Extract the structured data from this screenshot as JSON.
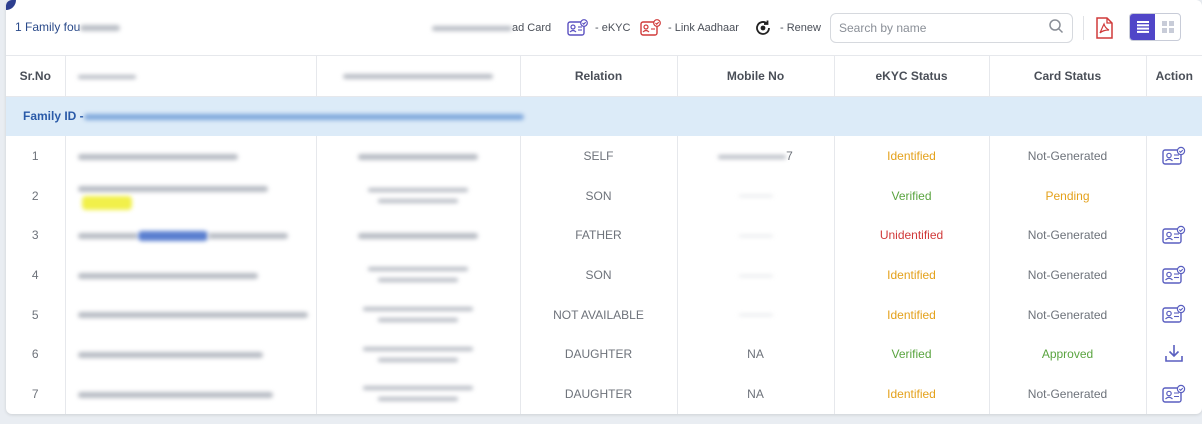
{
  "summary": {
    "found_text": "1 Family fou"
  },
  "legend": {
    "card_label": "ad Card",
    "ekyc_label": "- eKYC",
    "link_label": "- Link Aadhaar",
    "renew_label": "- Renew"
  },
  "search": {
    "placeholder": "Search by name"
  },
  "table": {
    "headers": {
      "srno": "Sr.No",
      "relation": "Relation",
      "mobile": "Mobile No",
      "ekyc": "eKYC Status",
      "card": "Card Status",
      "action": "Action"
    },
    "family_id_label": "Family ID -",
    "rows": [
      {
        "sr": "1",
        "relation": "SELF",
        "mobile": "7",
        "ekyc": "Identified",
        "card": "Not-Generated",
        "action_icon": "card-icon"
      },
      {
        "sr": "2",
        "relation": "SON",
        "mobile": "",
        "ekyc": "Verified",
        "card": "Pending",
        "action_icon": "none"
      },
      {
        "sr": "3",
        "relation": "FATHER",
        "mobile": "",
        "ekyc": "Unidentified",
        "card": "Not-Generated",
        "action_icon": "card-icon"
      },
      {
        "sr": "4",
        "relation": "SON",
        "mobile": "",
        "ekyc": "Identified",
        "card": "Not-Generated",
        "action_icon": "card-icon"
      },
      {
        "sr": "5",
        "relation": "NOT AVAILABLE",
        "mobile": "",
        "ekyc": "Identified",
        "card": "Not-Generated",
        "action_icon": "card-icon"
      },
      {
        "sr": "6",
        "relation": "DAUGHTER",
        "mobile": "NA",
        "ekyc": "Verified",
        "card": "Approved",
        "action_icon": "download-icon"
      },
      {
        "sr": "7",
        "relation": "DAUGHTER",
        "mobile": "NA",
        "ekyc": "Identified",
        "card": "Not-Generated",
        "action_icon": "card-icon"
      }
    ]
  },
  "colors": {
    "identified": "#e4a11b",
    "verified": "#5aa440",
    "unidentified": "#d03a3a",
    "family_row_bg": "#dcebf8",
    "toggle_active": "#5046c8"
  }
}
